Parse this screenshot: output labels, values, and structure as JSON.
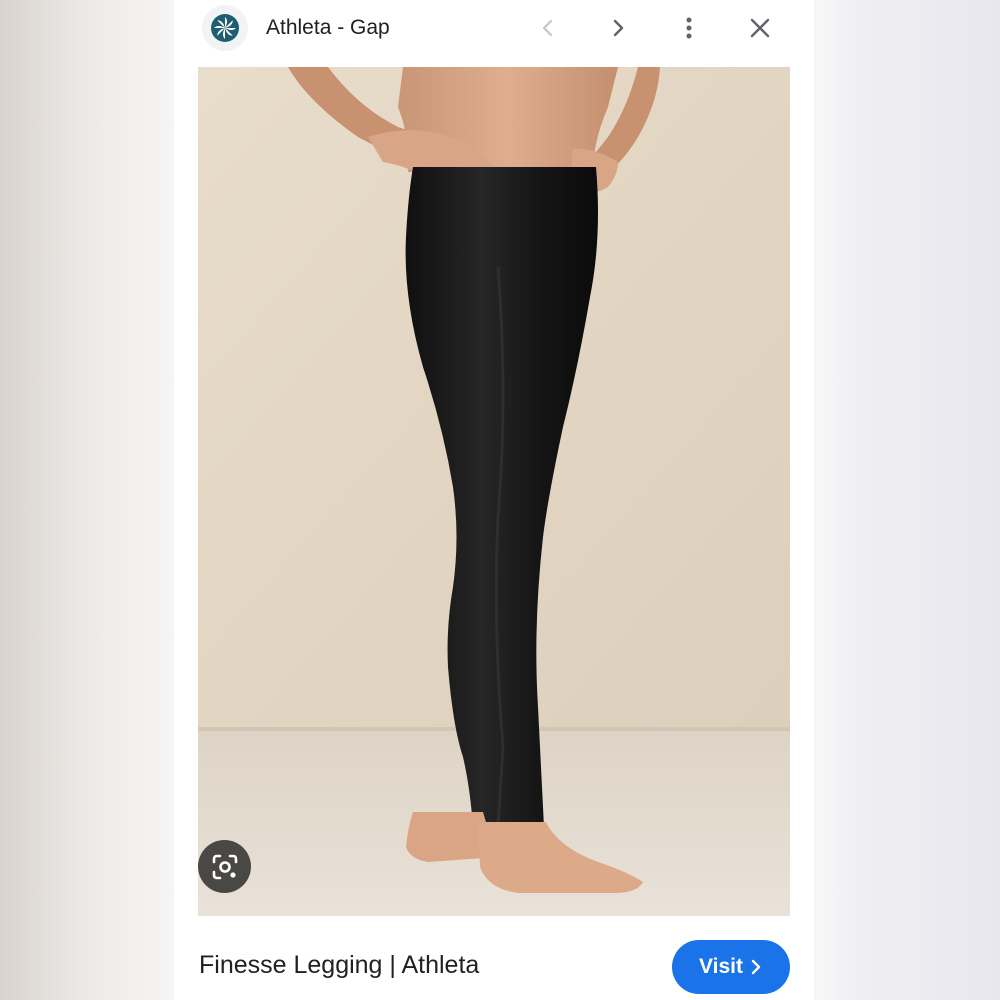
{
  "header": {
    "site_name": "Athleta - Gap",
    "logo_icon": "athleta-pinwheel-logo",
    "prev_icon": "chevron-left-icon",
    "next_icon": "chevron-right-icon",
    "more_icon": "more-vert-icon",
    "close_icon": "close-icon"
  },
  "image": {
    "subject": "Woman wearing black full-length leggings, hands on hips, barefoot, against a beige plaster wall"
  },
  "lens_icon": "google-lens-icon",
  "footer": {
    "caption": "Finesse Legging | Athleta",
    "visit_label": "Visit"
  },
  "colors": {
    "accent": "#1a73e8",
    "logo": "#1f5e72",
    "background_wall": "#e3d6c4"
  }
}
